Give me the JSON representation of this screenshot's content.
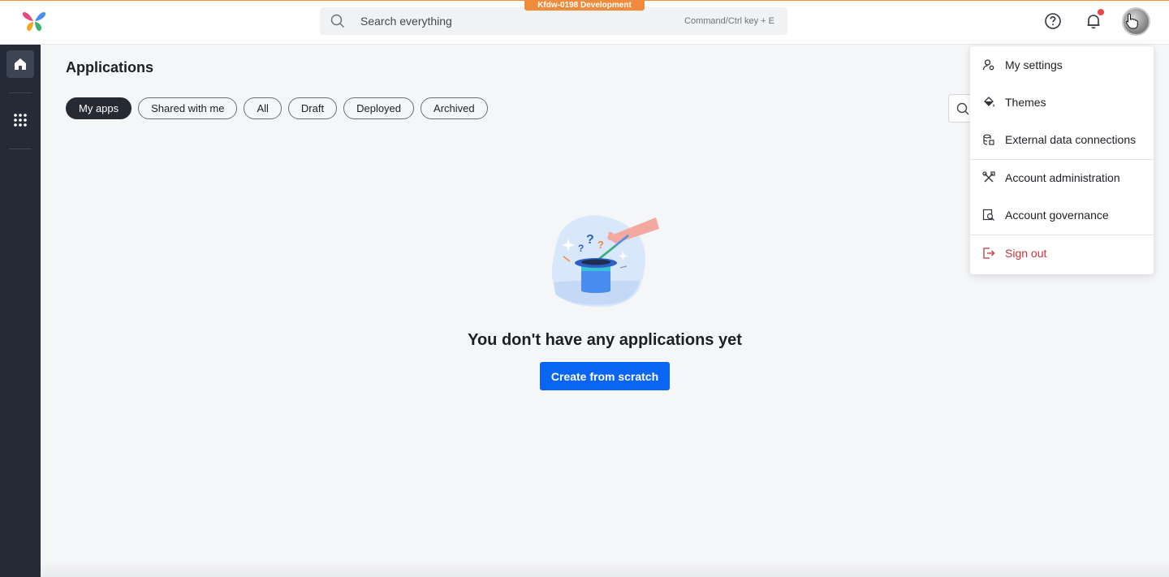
{
  "environment": {
    "label": "Kfdw-0198 Development",
    "color": "#f08a3c"
  },
  "header": {
    "search_placeholder": "Search everything",
    "search_shortcut": "Command/Ctrl key + E",
    "icons": [
      "butterfly-logo-icon",
      "help-icon",
      "bell-icon",
      "avatar"
    ],
    "notification_dot": true
  },
  "sidebar": {
    "items": [
      {
        "name": "home-icon",
        "active": true
      },
      {
        "name": "apps-grid-icon",
        "active": false
      }
    ]
  },
  "main": {
    "title": "Applications",
    "tabs": [
      {
        "label": "My apps",
        "active": true
      },
      {
        "label": "Shared with me",
        "active": false
      },
      {
        "label": "All",
        "active": false
      },
      {
        "label": "Draft",
        "active": false
      },
      {
        "label": "Deployed",
        "active": false
      },
      {
        "label": "Archived",
        "active": false
      }
    ],
    "empty_state": {
      "message": "You don't have any applications yet",
      "button": "Create from scratch"
    }
  },
  "user_menu": {
    "items": [
      {
        "label": "My settings",
        "icon": "user-settings-icon"
      },
      {
        "label": "Themes",
        "icon": "paint-bucket-icon"
      },
      {
        "label": "External data connections",
        "icon": "data-connection-icon"
      },
      {
        "label": "Account administration",
        "icon": "tools-icon"
      },
      {
        "label": "Account governance",
        "icon": "governance-icon"
      },
      {
        "label": "Sign out",
        "icon": "sign-out-icon",
        "danger": true
      }
    ]
  },
  "colors": {
    "primary": "#0a66f2",
    "sidebar": "#242b37",
    "danger": "#c7333a"
  }
}
